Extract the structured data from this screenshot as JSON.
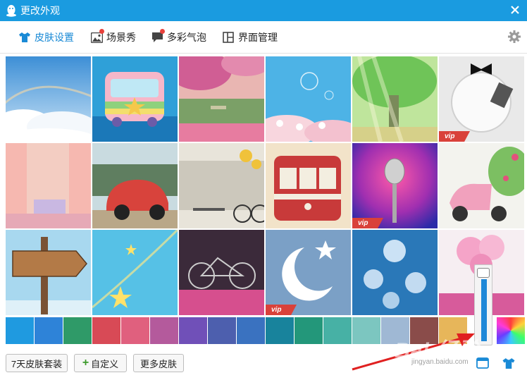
{
  "window": {
    "title": "更改外观"
  },
  "tabs": [
    {
      "label": "皮肤设置",
      "icon": "shirt-icon",
      "active": true
    },
    {
      "label": "场景秀",
      "icon": "picture-icon",
      "badge": true
    },
    {
      "label": "多彩气泡",
      "icon": "chat-bubble-icon",
      "badge": true
    },
    {
      "label": "界面管理",
      "icon": "layout-grid-icon"
    }
  ],
  "skins": [
    {
      "name": "sky-clouds",
      "vip": false
    },
    {
      "name": "rainbow-bus",
      "vip": false
    },
    {
      "name": "pink-tree-summer",
      "vip": false
    },
    {
      "name": "cherry-blossom-bubbles",
      "vip": false
    },
    {
      "name": "green-tree-sunlight",
      "vip": false
    },
    {
      "name": "plate-bowtie",
      "vip": true
    },
    {
      "name": "pink-bedroom",
      "vip": false
    },
    {
      "name": "red-beetle-car",
      "vip": false
    },
    {
      "name": "summer-bicycle-sunflowers",
      "vip": false
    },
    {
      "name": "red-tram",
      "vip": false
    },
    {
      "name": "microphone",
      "vip": true
    },
    {
      "name": "pink-scooter",
      "vip": false
    },
    {
      "name": "wooden-signpost",
      "vip": false
    },
    {
      "name": "blue-stars",
      "vip": false
    },
    {
      "name": "bicycle-pink-night",
      "vip": false
    },
    {
      "name": "moon-star",
      "vip": true
    },
    {
      "name": "dandelions",
      "vip": false
    },
    {
      "name": "pink-balloons",
      "vip": false
    }
  ],
  "vip_label": "vip",
  "swatches": [
    "#1f9ae0",
    "#2e83d8",
    "#2f9a68",
    "#d84a56",
    "#e0607e",
    "#b45a9c",
    "#7050b8",
    "#4d5fae",
    "#3a72c0",
    "#18839c",
    "#23977a",
    "#47b1a5",
    "#7cc6c0",
    "#9fb8d4",
    "#8a4c4a",
    "#e7b65a",
    "rainbow"
  ],
  "buttons": {
    "skin_pack": "7天皮肤套装",
    "custom": "自定义",
    "more": "更多皮肤"
  },
  "slider": {
    "fill_fraction": 0.9
  },
  "watermark": {
    "text": "Bai 经验",
    "url": "jingyan.baidu.com"
  },
  "colors": {
    "accent": "#1a9be0",
    "vip": "#d9413a",
    "active_tab": "#1a8ad6"
  }
}
